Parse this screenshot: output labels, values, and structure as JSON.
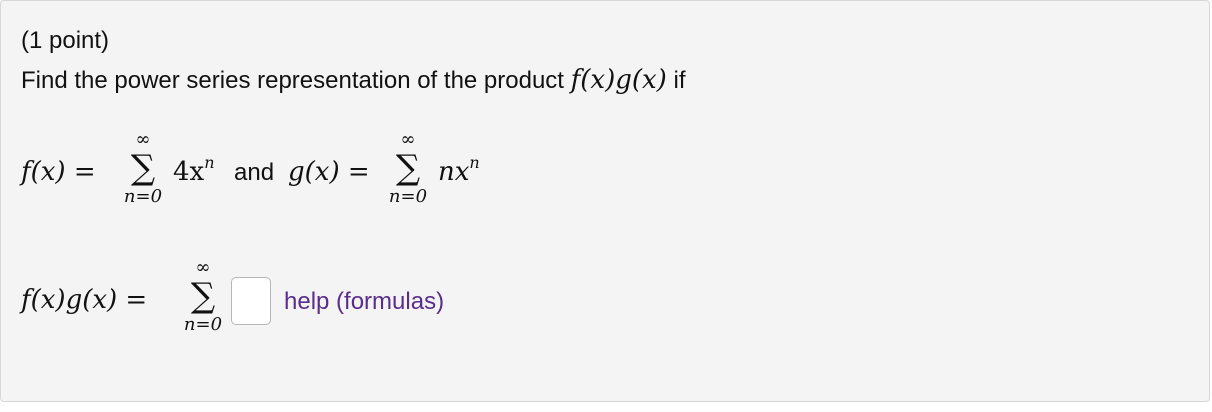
{
  "problem": {
    "points": "(1 point)",
    "question_text": "Find the power series representation of the product",
    "question_math": "f(x)g(x)",
    "question_suffix": "if"
  },
  "definitions": {
    "f_lhs": "f(x) =",
    "f_sum_upper": "∞",
    "f_sum_lower": "n=0",
    "f_term": "4x",
    "f_exp": "n",
    "connector": "and",
    "g_lhs": "g(x) =",
    "g_sum_upper": "∞",
    "g_sum_lower": "n=0",
    "g_term": "nx",
    "g_exp": "n"
  },
  "answer": {
    "lhs": "f(x)g(x) =",
    "sum_upper": "∞",
    "sum_lower": "n=0",
    "input_value": "",
    "help_link": "help (formulas)"
  },
  "sigma_symbol": "∑"
}
